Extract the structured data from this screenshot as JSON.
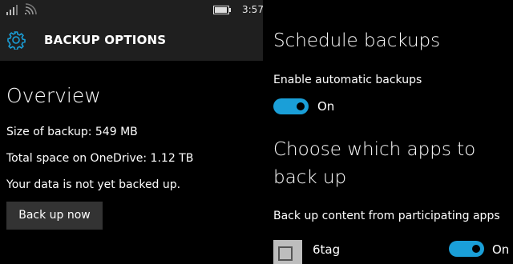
{
  "status": {
    "time": "3:57"
  },
  "header": {
    "title": "BACKUP OPTIONS"
  },
  "overview": {
    "title": "Overview",
    "size_line": "Size of backup: 549 MB",
    "space_line": "Total space on OneDrive: 1.12 TB",
    "status_line": "Your data is not yet backed up.",
    "backup_button": "Back up now"
  },
  "schedule": {
    "title": "Schedule backups",
    "enable_label": "Enable automatic backups",
    "toggle_state": "On"
  },
  "apps": {
    "title": "Choose which apps to back up",
    "subtitle": "Back up content from participating apps",
    "items": [
      {
        "name": "6tag",
        "toggle_state": "On"
      }
    ]
  },
  "colors": {
    "accent": "#1a9fd8",
    "header_bg": "#1f1f1f",
    "button_bg": "#333333"
  }
}
